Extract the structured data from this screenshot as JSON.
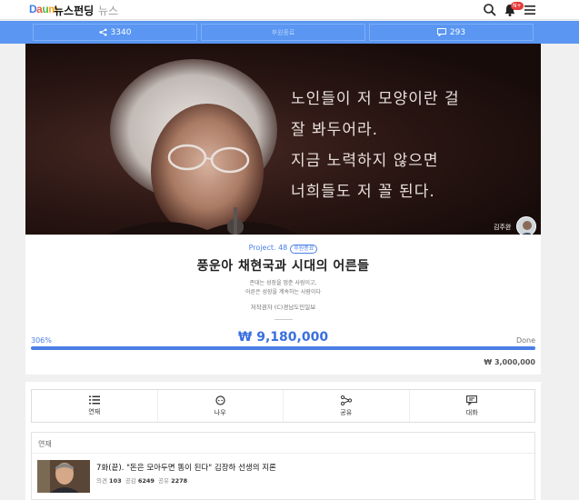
{
  "header": {
    "logo": {
      "d": "D",
      "a": "a",
      "u": "u",
      "m": "m"
    },
    "section_title": "뉴스펀딩",
    "section_sub": "뉴스",
    "notification_badge": "N+"
  },
  "stats": {
    "shares": "3340",
    "status": "후원종료",
    "comments": "293"
  },
  "hero": {
    "quote_lines": [
      "노인들이 저 모양이란 걸",
      "잘 봐두어라.",
      "지금 노력하지 않으면",
      "너희들도 저 꼴 된다."
    ],
    "author": "김주완"
  },
  "project": {
    "label": "Project. 48",
    "badge": "후원종료",
    "title": "풍운아 채현국과 시대의 어른들",
    "subtitle_1": "존대는 성장을 멈춘 사람이고,",
    "subtitle_2": "어른은 성장을 계속하는 사람이다",
    "copyright": "저작권자 (C)경남도민일보"
  },
  "funding": {
    "percent_label": "306%",
    "percent_value": 306,
    "amount": "₩ 9,180,000",
    "done": "Done",
    "goal": "₩ 3,000,000"
  },
  "actions": [
    {
      "label": "연재",
      "icon": "list-icon"
    },
    {
      "label": "나우",
      "icon": "chat-bubble-icon"
    },
    {
      "label": "공유",
      "icon": "share-icon"
    },
    {
      "label": "대화",
      "icon": "comment-icon"
    }
  ],
  "series": {
    "heading": "연재",
    "items": [
      {
        "title": "7화(끝). \"돈은 모아두면 똥이 된다\" 김장하 선생의 지론",
        "opinions_label": "의견",
        "opinions": "103",
        "likes_label": "공감",
        "likes": "6249",
        "shares_label": "공유",
        "shares": "2278"
      }
    ]
  },
  "colors": {
    "brand_blue": "#5a96f2",
    "accent_blue": "#4a7fe6"
  }
}
